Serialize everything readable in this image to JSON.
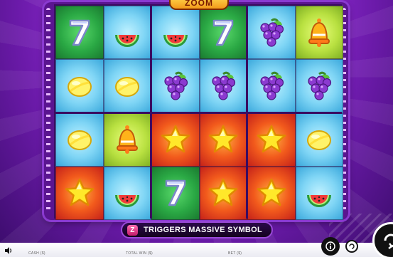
{
  "logo_text": "ZOOM",
  "banner": {
    "badge": "Z",
    "text": "TRIGGERS MASSIVE SYMBOL"
  },
  "bottom_bar": {
    "cash_label": "CASH ($)",
    "total_win_label": "TOTAL WIN ($)",
    "bet_label": "BET ($)"
  },
  "reels": {
    "rows": [
      [
        {
          "symbol": "seven",
          "bg": "green"
        },
        {
          "symbol": "watermelon",
          "bg": "blue"
        },
        {
          "symbol": "watermelon",
          "bg": "blue"
        },
        {
          "symbol": "seven",
          "bg": "green"
        },
        {
          "symbol": "grapes",
          "bg": "blue"
        },
        {
          "symbol": "bell",
          "bg": "lime"
        }
      ],
      [
        {
          "symbol": "lemon",
          "bg": "blue"
        },
        {
          "symbol": "lemon",
          "bg": "blue"
        },
        {
          "symbol": "grapes",
          "bg": "blue"
        },
        {
          "symbol": "grapes",
          "bg": "blue"
        },
        {
          "symbol": "grapes",
          "bg": "blue"
        },
        {
          "symbol": "grapes",
          "bg": "blue"
        }
      ],
      [
        {
          "symbol": "lemon",
          "bg": "blue"
        },
        {
          "symbol": "bell",
          "bg": "lime"
        },
        {
          "symbol": "star",
          "bg": "red"
        },
        {
          "symbol": "star",
          "bg": "red"
        },
        {
          "symbol": "star",
          "bg": "red"
        },
        {
          "symbol": "lemon",
          "bg": "blue"
        }
      ],
      [
        {
          "symbol": "star",
          "bg": "red"
        },
        {
          "symbol": "watermelon",
          "bg": "blue"
        },
        {
          "symbol": "seven",
          "bg": "green"
        },
        {
          "symbol": "star",
          "bg": "red"
        },
        {
          "symbol": "star",
          "bg": "red"
        },
        {
          "symbol": "watermelon",
          "bg": "blue"
        }
      ]
    ]
  },
  "icons": {
    "sound": "speaker-icon",
    "info": "info-icon",
    "spin": "spin-icon"
  }
}
